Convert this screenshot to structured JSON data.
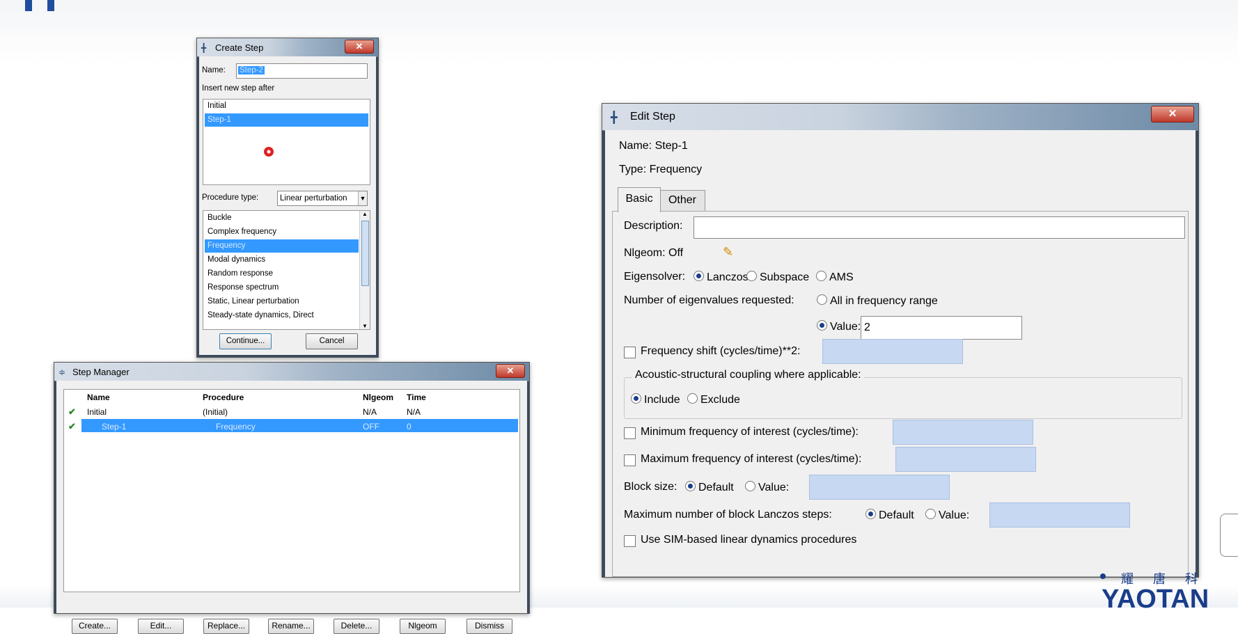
{
  "create_step": {
    "title": "Create Step",
    "name_label": "Name:",
    "name_value": "Step-2",
    "insert_label": "Insert new step after",
    "insert_items": [
      "Initial",
      "Step-1"
    ],
    "procedure_label": "Procedure type:",
    "procedure_value": "Linear perturbation",
    "procedures": [
      "Buckle",
      "Complex frequency",
      "Frequency",
      "Modal dynamics",
      "Random response",
      "Response spectrum",
      "Static, Linear perturbation",
      "Steady-state dynamics, Direct"
    ],
    "continue_label": "Continue...",
    "cancel_label": "Cancel"
  },
  "step_manager": {
    "title": "Step Manager",
    "columns": [
      "Name",
      "Procedure",
      "Nlgeom",
      "Time"
    ],
    "rows": [
      {
        "name": "Initial",
        "procedure": "(Initial)",
        "nlgeom": "N/A",
        "time": "N/A"
      },
      {
        "name": "Step-1",
        "procedure": "Frequency",
        "nlgeom": "OFF",
        "time": "0"
      }
    ],
    "buttons": [
      "Create...",
      "Edit...",
      "Replace...",
      "Rename...",
      "Delete...",
      "Nlgeom",
      "Dismiss"
    ]
  },
  "edit_step": {
    "title": "Edit Step",
    "name_line": "Name:  Step-1",
    "type_line": "Type:  Frequency",
    "tabs": [
      "Basic",
      "Other"
    ],
    "description_label": "Description:",
    "description_value": "",
    "nlgeom_label": "Nlgeom:  Off",
    "eigensolver_label": "Eigensolver:",
    "eigensolver_options": [
      "Lanczos",
      "Subspace",
      "AMS"
    ],
    "num_eigen_label": "Number of eigenvalues requested:",
    "all_in_range": "All in frequency range",
    "value_label": "Value:",
    "value": "2",
    "freq_shift_label": "Frequency shift (cycles/time)**2:",
    "acoustic_label": "Acoustic-structural coupling where applicable:",
    "include_label": "Include",
    "exclude_label": "Exclude",
    "min_freq_label": "Minimum frequency of interest (cycles/time):",
    "max_freq_label": "Maximum frequency of interest (cycles/time):",
    "block_size_label": "Block size:",
    "default_label": "Default",
    "block_value_label": "Value:",
    "max_block_label": "Maximum number of block Lanczos steps:",
    "max_block_default": "Default",
    "max_block_value_label": "Value:",
    "sim_label": "Use SIM-based linear dynamics procedures"
  },
  "logo": {
    "cn": "耀唐科",
    "en": "YAOTAN"
  }
}
